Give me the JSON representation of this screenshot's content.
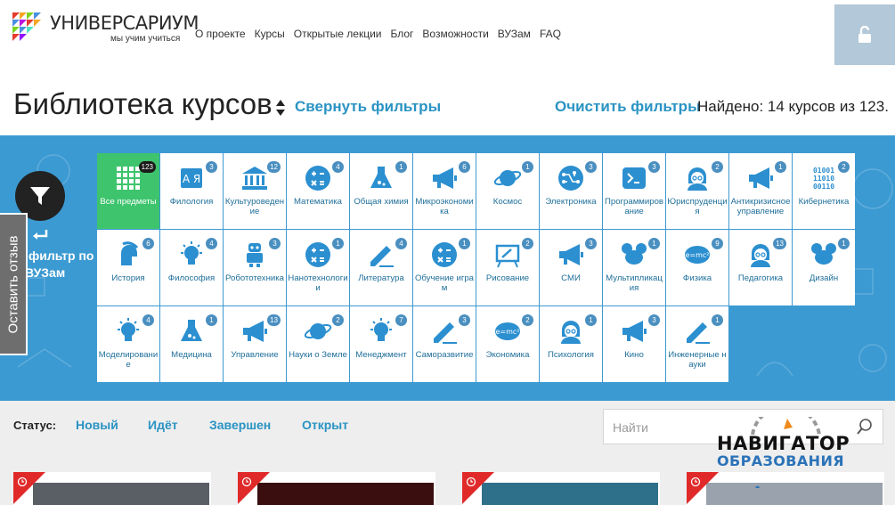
{
  "header": {
    "logo_title": "УНИВЕРСАРИУМ",
    "logo_subtitle": "мы учим учиться",
    "nav": [
      "О проекте",
      "Курсы",
      "Открытые лекции",
      "Блог",
      "Возможности",
      "ВУЗам",
      "FAQ"
    ],
    "login_icon": "lock-open-icon"
  },
  "title_row": {
    "title": "Библиотека курсов",
    "collapse_filters": "Свернуть фильтры",
    "clear_filters": "Очистить фильтры",
    "found": "Найдено: 14 курсов из 123."
  },
  "filter": {
    "label_line1": "фильтр по",
    "label_line2": "ВУЗам",
    "feedback": "Оставить отзыв"
  },
  "colors": {
    "accent": "#2a93c3",
    "filter_bg": "#3c9ad2",
    "active_tile": "#3ec46d",
    "icon_blue": "#2b8fd0"
  },
  "subjects": [
    {
      "label": "Все предметы",
      "count": "123",
      "icon": "grid-icon",
      "active": true
    },
    {
      "label": "Филология",
      "count": "3",
      "icon": "book-icon"
    },
    {
      "label": "Культуроведение",
      "count": "12",
      "icon": "museum-icon"
    },
    {
      "label": "Математика",
      "count": "4",
      "icon": "math-icon"
    },
    {
      "label": "Общая химия",
      "count": "1",
      "icon": "flask-icon"
    },
    {
      "label": "Микроэкономика",
      "count": "6",
      "icon": "megaphone-icon"
    },
    {
      "label": "Космос",
      "count": "1",
      "icon": "planet-icon"
    },
    {
      "label": "Электроника",
      "count": "3",
      "icon": "circuit-icon"
    },
    {
      "label": "Программирование",
      "count": "3",
      "icon": "terminal-icon"
    },
    {
      "label": "Юриспруденция",
      "count": "2",
      "icon": "person-icon"
    },
    {
      "label": "Антикризисное управление",
      "count": "1",
      "icon": "megaphone-icon"
    },
    {
      "label": "Кибернетика",
      "count": "2",
      "icon": "binary-icon"
    },
    {
      "label": "История",
      "count": "6",
      "icon": "helmet-icon"
    },
    {
      "label": "Философия",
      "count": "4",
      "icon": "lightbulb-icon"
    },
    {
      "label": "Робототехника",
      "count": "3",
      "icon": "robot-icon"
    },
    {
      "label": "Нанотехнологии",
      "count": "1",
      "icon": "math-icon"
    },
    {
      "label": "Литература",
      "count": "4",
      "icon": "pen-icon"
    },
    {
      "label": "Обучение играм",
      "count": "1",
      "icon": "math-icon"
    },
    {
      "label": "Рисование",
      "count": "2",
      "icon": "easel-icon"
    },
    {
      "label": "СМИ",
      "count": "3",
      "icon": "megaphone-icon"
    },
    {
      "label": "Мультипликация",
      "count": "1",
      "icon": "mouse-icon"
    },
    {
      "label": "Физика",
      "count": "9",
      "icon": "formula-icon"
    },
    {
      "label": "Педагогика",
      "count": "13",
      "icon": "person-icon"
    },
    {
      "label": "Дизайн",
      "count": "1",
      "icon": "mouse-icon"
    },
    {
      "label": "Моделирование",
      "count": "4",
      "icon": "lightbulb-icon"
    },
    {
      "label": "Медицина",
      "count": "1",
      "icon": "flask-icon"
    },
    {
      "label": "Управление",
      "count": "13",
      "icon": "megaphone-icon"
    },
    {
      "label": "Науки о Земле",
      "count": "2",
      "icon": "planet-icon"
    },
    {
      "label": "Менеджмент",
      "count": "7",
      "icon": "lightbulb-icon"
    },
    {
      "label": "Саморазвитие",
      "count": "3",
      "icon": "pen-icon"
    },
    {
      "label": "Экономика",
      "count": "2",
      "icon": "formula-icon"
    },
    {
      "label": "Психология",
      "count": "1",
      "icon": "person-icon"
    },
    {
      "label": "Кино",
      "count": "3",
      "icon": "megaphone-icon"
    },
    {
      "label": "Инженерные науки",
      "count": "1",
      "icon": "pen-icon"
    }
  ],
  "status": {
    "label": "Статус:",
    "options": [
      "Новый",
      "Идёт",
      "Завершен",
      "Открыт"
    ]
  },
  "search": {
    "placeholder": "Найти"
  },
  "watermark": {
    "line1": "НАВИГАТОР",
    "line2": "ОБРАЗОВАНИЯ"
  }
}
